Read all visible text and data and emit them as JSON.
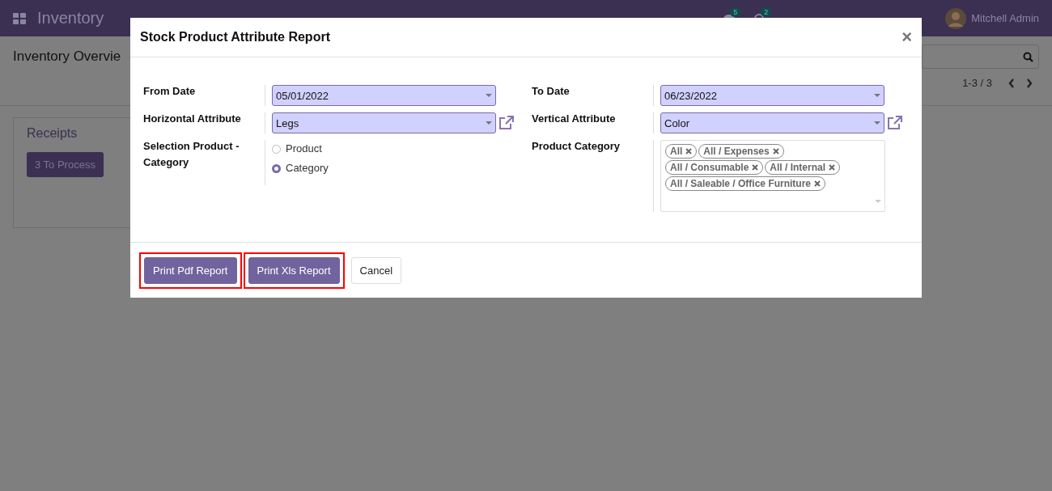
{
  "navbar": {
    "app_name": "Inventory",
    "messages_count": "5",
    "activities_count": "2",
    "user": "Mitchell Admin"
  },
  "control_panel": {
    "title": "Inventory Overvie",
    "pager": "1-3 / 3"
  },
  "card": {
    "title": "Receipts",
    "button": "3 To Process"
  },
  "dialog": {
    "title": "Stock Product Attribute Report",
    "close": "×",
    "left": [
      {
        "kind": "select",
        "label": "From Date",
        "value": "05/01/2022",
        "link": false
      },
      {
        "kind": "select",
        "label": "Horizontal Attribute",
        "value": "Legs",
        "link": true
      },
      {
        "kind": "radio",
        "label": "Selection Product - Category",
        "options": [
          {
            "label": "Product",
            "selected": false
          },
          {
            "label": "Category",
            "selected": true
          }
        ]
      }
    ],
    "right": [
      {
        "kind": "select",
        "label": "To Date",
        "value": "06/23/2022",
        "link": false
      },
      {
        "kind": "select",
        "label": "Vertical Attribute",
        "value": "Color",
        "link": true
      },
      {
        "kind": "tags",
        "label": "Product Category",
        "tags": [
          "All",
          "All / Expenses",
          "All / Consumable",
          "All / Internal",
          "All / Saleable / Office Furniture"
        ]
      }
    ],
    "buttons": [
      {
        "label": "Print Pdf Report",
        "kind": "primary",
        "highlighted": true
      },
      {
        "label": "Print Xls Report",
        "kind": "primary",
        "highlighted": true
      },
      {
        "label": "Cancel",
        "kind": "secondary",
        "highlighted": false
      }
    ]
  }
}
